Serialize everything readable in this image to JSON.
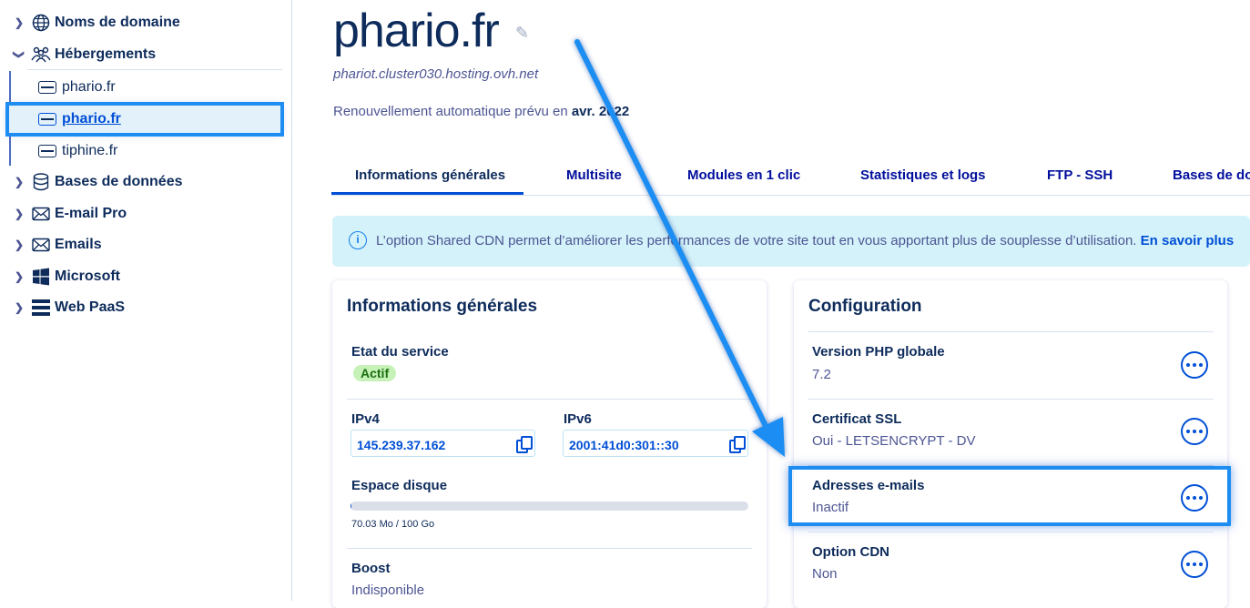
{
  "sidebar": {
    "items": [
      {
        "label": "Noms de domaine",
        "icon": "globe-icon"
      },
      {
        "label": "Hébergements",
        "icon": "people-icon"
      },
      {
        "label": "Bases de données",
        "icon": "database-icon"
      },
      {
        "label": "E-mail Pro",
        "icon": "envelope-icon"
      },
      {
        "label": "Emails",
        "icon": "envelope-icon"
      },
      {
        "label": "Microsoft",
        "icon": "windows-icon"
      },
      {
        "label": "Web PaaS",
        "icon": "stack-icon"
      }
    ],
    "hosting_items": [
      {
        "label": "phario.fr"
      },
      {
        "label": "phario.fr"
      },
      {
        "label": "tiphine.fr"
      }
    ]
  },
  "header": {
    "title": "phario.fr",
    "cluster": "phariot.cluster030.hosting.ovh.net",
    "renew_prefix": "Renouvellement automatique prévu en",
    "renew_date": "avr. 2022"
  },
  "tabs": [
    "Informations générales",
    "Multisite",
    "Modules en 1 clic",
    "Statistiques et logs",
    "FTP - SSH",
    "Bases de don"
  ],
  "banner": {
    "text": "L’option Shared CDN permet d’améliorer les performances de votre site tout en vous apportant plus de souplesse d’utilisation.",
    "link": "En savoir plus"
  },
  "general": {
    "title": "Informations générales",
    "state_label": "Etat du service",
    "state_value": "Actif",
    "ipv4_label": "IPv4",
    "ipv4_value": "145.239.37.162",
    "ipv6_label": "IPv6",
    "ipv6_value": "2001:41d0:301::30",
    "disk_label": "Espace disque",
    "disk_value": "70.03 Mo / 100 Go",
    "disk_fraction": 0.0007,
    "boost_label": "Boost",
    "boost_value": "Indisponible"
  },
  "config": {
    "title": "Configuration",
    "rows": [
      {
        "label": "Version PHP globale",
        "value": "7.2"
      },
      {
        "label": "Certificat SSL",
        "value": "Oui - LETSENCRYPT - DV"
      },
      {
        "label": "Adresses e-mails",
        "value": "Inactif"
      },
      {
        "label": "Option CDN",
        "value": "Non"
      }
    ]
  },
  "colors": {
    "accent": "#004fd6",
    "highlight": "#1d8df2",
    "banner_bg": "#d4f2fa"
  }
}
